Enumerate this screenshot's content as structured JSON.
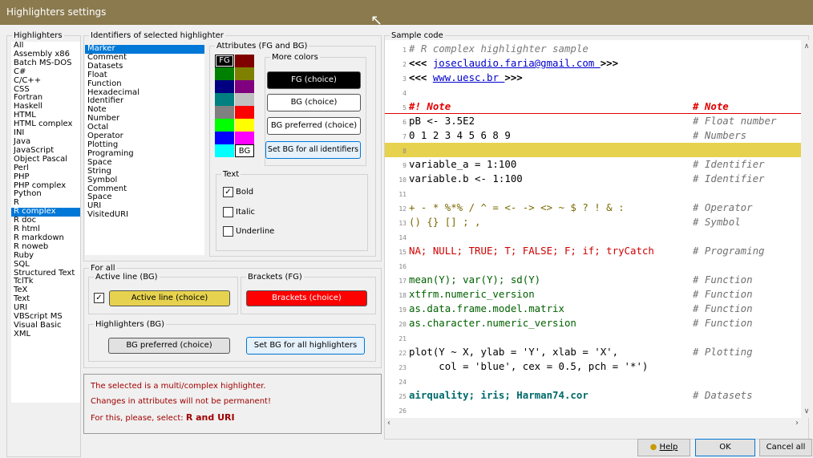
{
  "window": {
    "title": "Highlighters settings"
  },
  "highlighters": {
    "legend": "Highlighters",
    "items": [
      "All",
      "Assembly x86",
      "Batch MS-DOS",
      "C#",
      "C/C++",
      "CSS",
      "Fortran",
      "Haskell",
      "HTML",
      "HTML complex",
      "INI",
      "Java",
      "JavaScript",
      "Object Pascal",
      "Perl",
      "PHP",
      "PHP complex",
      "Python",
      "R",
      "R complex",
      "R doc",
      "R html",
      "R markdown",
      "R noweb",
      "Ruby",
      "SQL",
      "Structured Text",
      "TclTk",
      "TeX",
      "Text",
      "URI",
      "VBScript MS",
      "Visual Basic",
      "XML"
    ],
    "selected": "R complex"
  },
  "identifiers": {
    "legend": "Identifiers of selected highlighter",
    "items": [
      "Marker",
      "Comment",
      "Datasets",
      "Float",
      "Function",
      "Hexadecimal",
      "Identifier",
      "Note",
      "Number",
      "Octal",
      "Operator",
      "Plotting",
      "Programing",
      "Space",
      "String",
      "Symbol",
      "Comment",
      "Space",
      "URI",
      "VisitedURI"
    ],
    "selected": "Marker"
  },
  "attributes": {
    "legend": "Attributes (FG and BG)",
    "fg_label": "FG",
    "bg_label": "BG",
    "swatch_colors": [
      "#000000",
      "#800000",
      "#008000",
      "#808000",
      "#000080",
      "#800080",
      "#008080",
      "#c0c0c0",
      "#808080",
      "#ff0000",
      "#00ff00",
      "#ffff00",
      "#0000ff",
      "#ff00ff",
      "#00ffff",
      "#ffffff"
    ],
    "more_colors": "More colors",
    "fg_choice": "FG (choice)",
    "bg_choice": "BG (choice)",
    "bg_preferred": "BG preferred  (choice)",
    "set_bg_identifiers": "Set BG for all identifiers",
    "text_legend": "Text",
    "bold": "Bold",
    "italic": "Italic",
    "underline": "Underline",
    "bold_checked": true
  },
  "for_all": {
    "legend": "For all",
    "active_line_legend": "Active line (BG)",
    "active_line_btn": "Active line (choice)",
    "active_line_color": "#e6d24e",
    "brackets_legend": "Brackets (FG)",
    "brackets_btn": "Brackets (choice)",
    "brackets_color": "#ff0000",
    "highlighters_legend": "Highlighters (BG)",
    "bg_preferred": "BG preferred (choice)",
    "set_bg_highlighters": "Set BG for all highlighters"
  },
  "message": {
    "line1": "The selected is a multi/complex highlighter.",
    "line2": "Changes in attributes will not be permanent!",
    "line3_prefix": "For this, please, select:",
    "line3_bold": "R  and URI"
  },
  "sample": {
    "legend": "Sample code",
    "lines": [
      {
        "n": "1",
        "code": "# R complex highlighter sample",
        "comment": ""
      },
      {
        "n": "2",
        "code": "<<< joseclaudio.faria@gmail.com >>>",
        "comment": ""
      },
      {
        "n": "3",
        "code": "<<< www.uesc.br >>>",
        "comment": ""
      },
      {
        "n": "4",
        "code": "",
        "comment": ""
      },
      {
        "n": "5",
        "code": "#! Note",
        "comment": "# Note"
      },
      {
        "n": "6",
        "code": "pB <- 3.5E2",
        "comment": "# Float number"
      },
      {
        "n": "7",
        "code": "0 1 2 3 4 5 6 8 9",
        "comment": "# Numbers"
      },
      {
        "n": "8",
        "code": "",
        "comment": ""
      },
      {
        "n": "9",
        "code": "variable_a = 1:100",
        "comment": "# Identifier"
      },
      {
        "n": "10",
        "code": "variable.b <- 1:100",
        "comment": "# Identifier"
      },
      {
        "n": "11",
        "code": "",
        "comment": ""
      },
      {
        "n": "12",
        "code": "+ - * %*% / ^ = <- -> <> ~ $ ? ! & :",
        "comment": "# Operator"
      },
      {
        "n": "13",
        "code": "() {} [] ; ,",
        "comment": "# Symbol"
      },
      {
        "n": "14",
        "code": "",
        "comment": ""
      },
      {
        "n": "15",
        "code": "NA; NULL; TRUE; T; FALSE; F; if; tryCatch",
        "comment": "# Programing"
      },
      {
        "n": "16",
        "code": "",
        "comment": ""
      },
      {
        "n": "17",
        "code": "mean(Y); var(Y); sd(Y)",
        "comment": "# Function"
      },
      {
        "n": "18",
        "code": "xtfrm.numeric_version",
        "comment": "# Function"
      },
      {
        "n": "19",
        "code": "as.data.frame.model.matrix",
        "comment": "# Function"
      },
      {
        "n": "20",
        "code": "as.character.numeric_version",
        "comment": "# Function"
      },
      {
        "n": "21",
        "code": "",
        "comment": ""
      },
      {
        "n": "22",
        "code": "plot(Y ~ X, ylab = 'Y', xlab = 'X',",
        "comment": "# Plotting"
      },
      {
        "n": "23",
        "code": "     col = 'blue', cex = 0.5, pch = '*')",
        "comment": ""
      },
      {
        "n": "24",
        "code": "",
        "comment": ""
      },
      {
        "n": "25",
        "code": "airquality; iris; Harman74.cor",
        "comment": "# Datasets"
      },
      {
        "n": "26",
        "code": "",
        "comment": ""
      }
    ]
  },
  "footer": {
    "help": "Help",
    "ok": "OK",
    "cancel": "Cancel all"
  }
}
